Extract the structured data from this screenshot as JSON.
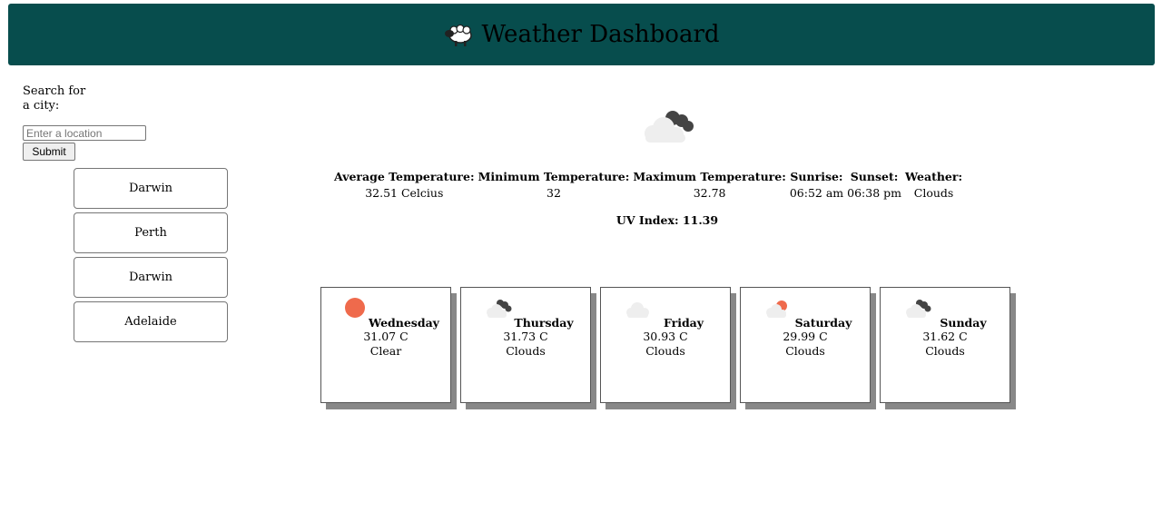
{
  "header": {
    "title": "Weather Dashboard",
    "logo_icon": "sheep-icon"
  },
  "search": {
    "label": "Search for a city:",
    "placeholder": "Enter a location",
    "value": "",
    "submit_label": "Submit"
  },
  "history": [
    "Darwin",
    "Perth",
    "Darwin",
    "Adelaide"
  ],
  "current": {
    "icon": "cloudy-icon",
    "headers": {
      "avg": "Average Temperature:",
      "min": "Minimum Temperature:",
      "max": "Maximum Temperature:",
      "sunrise": "Sunrise:",
      "sunset": "Sunset:",
      "weather": "Weather:"
    },
    "values": {
      "avg": "32.51 Celcius",
      "min": "32",
      "max": "32.78",
      "sunrise": "06:52 am",
      "sunset": "06:38 pm",
      "weather": "Clouds"
    },
    "uv": "UV Index: 11.39"
  },
  "forecast": [
    {
      "day": "Wednesday",
      "temp": "31.07 C",
      "cond": "Clear",
      "icon": "sun-icon"
    },
    {
      "day": "Thursday",
      "temp": "31.73 C",
      "cond": "Clouds",
      "icon": "dark-clouds-icon"
    },
    {
      "day": "Friday",
      "temp": "30.93 C",
      "cond": "Clouds",
      "icon": "cloud-icon"
    },
    {
      "day": "Saturday",
      "temp": "29.99 C",
      "cond": "Clouds",
      "icon": "sun-behind-cloud-icon"
    },
    {
      "day": "Sunday",
      "temp": "31.62 C",
      "cond": "Clouds",
      "icon": "dark-clouds-icon"
    }
  ],
  "colors": {
    "header": "#074d4d",
    "sun": "#ef6a4c",
    "cloud_light": "#eeeeee",
    "cloud_dark": "#444444"
  }
}
